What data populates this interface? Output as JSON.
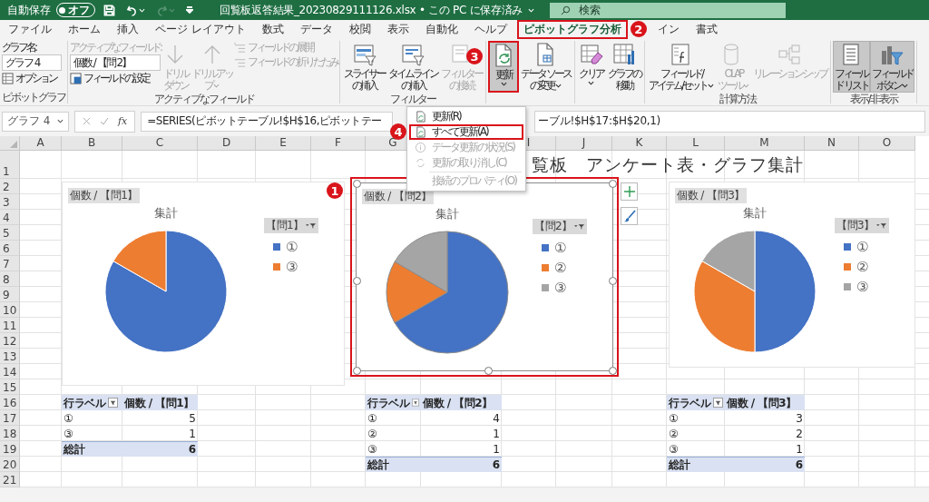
{
  "title_bar": {
    "autosave_label": "自動保存",
    "autosave_toggle": {
      "label": "オフ",
      "on": false
    },
    "quick_access": [
      {
        "kind": "save",
        "disabled": false
      },
      {
        "kind": "undo",
        "disabled": false
      },
      {
        "kind": "redo",
        "disabled": true
      },
      {
        "kind": "customize",
        "disabled": false
      }
    ],
    "filename": "回覧板返答結果_20230829111126.xlsx • この PC に保存済み",
    "search": {
      "placeholder": "検索"
    }
  },
  "tabs": [
    {
      "label": "ファイル",
      "selected": false,
      "highlighted": false
    },
    {
      "label": "ホーム",
      "selected": false,
      "highlighted": false
    },
    {
      "label": "挿入",
      "selected": false,
      "highlighted": false
    },
    {
      "label": "ページ レイアウト",
      "selected": false,
      "highlighted": false
    },
    {
      "label": "数式",
      "selected": false,
      "highlighted": false
    },
    {
      "label": "データ",
      "selected": false,
      "highlighted": false
    },
    {
      "label": "校閲",
      "selected": false,
      "highlighted": false
    },
    {
      "label": "表示",
      "selected": false,
      "highlighted": false
    },
    {
      "label": "自動化",
      "selected": false,
      "highlighted": false
    },
    {
      "label": "ヘルプ",
      "selected": false,
      "highlighted": false
    },
    {
      "label": "ピボットグラフ分析",
      "selected": true,
      "highlighted": true,
      "badge": "2"
    },
    {
      "label": "イン",
      "selected": false,
      "highlighted": false
    },
    {
      "label": "書式",
      "selected": false,
      "highlighted": false
    }
  ],
  "ribbon": {
    "groups": [
      {
        "label": "ピボットグラフ",
        "columns": [
          [
            {
              "kind": "caption",
              "label": "グラフ名:",
              "disabled": false
            },
            {
              "kind": "field",
              "value": "グラフ 4"
            },
            {
              "kind": "small",
              "label": "オプション",
              "disabled": false
            }
          ]
        ]
      },
      {
        "label": "アクティブなフィールド",
        "columns": [
          [
            {
              "kind": "caption",
              "label": "アクティブなフィールド:",
              "disabled": true
            },
            {
              "kind": "field",
              "value": "個数 / 【問 2】"
            },
            {
              "kind": "small",
              "label": "フィールドの設定",
              "disabled": false
            }
          ],
          [
            {
              "kind": "large",
              "lines": [
                "ドリル",
                "ダウン"
              ],
              "disabled": true,
              "pressed": false,
              "dropdown": false,
              "highlighted": false
            }
          ],
          [
            {
              "kind": "large",
              "lines": [
                "ドリルアッ",
                "プ"
              ],
              "disabled": true,
              "pressed": false,
              "dropdown": true,
              "highlighted": false
            }
          ],
          [
            {
              "kind": "small",
              "label": "フィールドの展開",
              "disabled": true
            },
            {
              "kind": "small",
              "label": "フィールドの折りたたみ",
              "disabled": true
            }
          ]
        ]
      },
      {
        "label": "フィルター",
        "columns": [
          [
            {
              "kind": "large",
              "lines": [
                "スライサー",
                "の挿入"
              ],
              "disabled": false,
              "pressed": false,
              "dropdown": false,
              "highlighted": false
            }
          ],
          [
            {
              "kind": "large",
              "lines": [
                "タイムライン",
                "の挿入"
              ],
              "disabled": false,
              "pressed": false,
              "dropdown": false,
              "highlighted": false
            }
          ],
          [
            {
              "kind": "large",
              "lines": [
                "フィルター",
                "の接続"
              ],
              "disabled": true,
              "pressed": false,
              "dropdown": false,
              "highlighted": false
            }
          ]
        ]
      },
      {
        "columns": [
          [
            {
              "kind": "large",
              "lines": [
                "更新"
              ],
              "disabled": false,
              "pressed": true,
              "dropdown": true,
              "highlighted": true,
              "badge": "3",
              "menu": {
                "items": [
                  {
                    "label": "更新(R)",
                    "disabled": false,
                    "highlighted": false
                  },
                  {
                    "label": "すべて更新(A)",
                    "disabled": false,
                    "highlighted": true,
                    "badge": "4"
                  },
                  {
                    "label": "データ更新の状況(S)",
                    "disabled": true,
                    "highlighted": false
                  },
                  {
                    "label": "更新の取り消し(C)",
                    "disabled": true,
                    "highlighted": false
                  },
                  {
                    "label": "接続のプロパティ(O)",
                    "disabled": true,
                    "highlighted": false
                  }
                ]
              }
            }
          ],
          [
            {
              "kind": "large",
              "lines": [
                "データ ソース",
                "の変更"
              ],
              "disabled": false,
              "pressed": false,
              "dropdown": true,
              "highlighted": false
            }
          ]
        ]
      },
      {
        "columns": [
          [
            {
              "kind": "large",
              "lines": [
                "クリア"
              ],
              "disabled": false,
              "pressed": false,
              "dropdown": true,
              "highlighted": false
            }
          ],
          [
            {
              "kind": "large",
              "lines": [
                "グラフの",
                "移動"
              ],
              "disabled": false,
              "pressed": false,
              "dropdown": false,
              "highlighted": false
            }
          ]
        ]
      },
      {
        "label": "計算方法",
        "columns": [
          [
            {
              "kind": "large",
              "lines": [
                "フィールド/",
                "アイテム/セット"
              ],
              "disabled": false,
              "pressed": false,
              "dropdown": true,
              "highlighted": false
            }
          ],
          [
            {
              "kind": "large",
              "lines": [
                "OLAP",
                "ツール"
              ],
              "disabled": true,
              "pressed": false,
              "dropdown": true,
              "highlighted": false
            }
          ],
          [
            {
              "kind": "large",
              "lines": [
                "リレーションシップ"
              ],
              "disabled": true,
              "pressed": false,
              "dropdown": false,
              "highlighted": false
            }
          ]
        ]
      },
      {
        "label": "表示/非表示",
        "columns": [
          [
            {
              "kind": "large",
              "lines": [
                "フィール",
                "ド リスト"
              ],
              "disabled": false,
              "pressed": true,
              "dropdown": false,
              "highlighted": false
            }
          ],
          [
            {
              "kind": "large",
              "lines": [
                "フィールド",
                "ボタン"
              ],
              "disabled": false,
              "pressed": true,
              "dropdown": true,
              "highlighted": false
            }
          ]
        ]
      }
    ]
  },
  "formula_bar": {
    "name_box": "グラフ 4",
    "function_button": "fx",
    "formula_start": "=SERIES(ピボットテーブル!$H$16,ピボットテー",
    "formula_end": "ーブル!$H$17:$H$20,1)"
  },
  "sheet": {
    "columns": [
      {
        "label": "A"
      },
      {
        "label": "B"
      },
      {
        "label": "C"
      },
      {
        "label": "D"
      },
      {
        "label": "E"
      },
      {
        "label": "F"
      },
      {
        "label": "G"
      },
      {},
      {
        "label": "I"
      },
      {
        "label": "J"
      },
      {
        "label": "K"
      },
      {
        "label": "L"
      },
      {
        "label": "M"
      },
      {
        "label": "N"
      },
      {
        "label": "O"
      }
    ],
    "rows": [
      "1",
      "2",
      "3",
      "4",
      "5",
      "6",
      "7",
      "8",
      "9",
      "10",
      "11",
      "12",
      "13",
      "14",
      "15",
      "16",
      "17",
      "18",
      "19",
      "20",
      "21"
    ],
    "title": "覧板　アンケート表・グラフ集計",
    "charts": [
      {
        "field_button": "個数 / 【問1】",
        "legend_button": "【問1】",
        "selected": false,
        "highlighted": false,
        "legend": [
          {
            "label": "①",
            "color": "#4472c4"
          },
          {
            "label": "③",
            "color": "#ed7d31"
          }
        ],
        "chart_data": {
          "type": "pie",
          "title": "集計",
          "series": [
            {
              "values": [
                83.3,
                16.7
              ]
            }
          ]
        }
      },
      {
        "field_button": "個数 / 【問2】",
        "legend_button": "【問2】",
        "selected": true,
        "highlighted": true,
        "badge": "1",
        "legend": [
          {
            "label": "①",
            "color": "#4472c4"
          },
          {
            "label": "②",
            "color": "#ed7d31"
          },
          {
            "label": "③",
            "color": "#a5a5a5"
          }
        ],
        "chart_data": {
          "type": "pie",
          "title": "集計",
          "series": [
            {
              "values": [
                66.7,
                16.7,
                16.6
              ]
            }
          ]
        }
      },
      {
        "field_button": "個数 / 【問3】",
        "legend_button": "【問3】",
        "selected": false,
        "highlighted": false,
        "legend": [
          {
            "label": "①",
            "color": "#4472c4"
          },
          {
            "label": "②",
            "color": "#ed7d31"
          },
          {
            "label": "③",
            "color": "#a5a5a5"
          }
        ],
        "chart_data": {
          "type": "pie",
          "title": "集計",
          "series": [
            {
              "values": [
                50,
                33.3,
                16.7
              ]
            }
          ]
        }
      }
    ],
    "pivot_tables": [
      {
        "row_header": "行ラベル",
        "value_header": "個数 / 【問1】",
        "rows": [
          {
            "label": "①",
            "value": "5"
          },
          {
            "label": "③",
            "value": "1"
          }
        ],
        "total": {
          "label": "総計",
          "value": "6"
        }
      },
      {
        "row_header": "行ラベル",
        "value_header": "個数 / 【問2】",
        "rows": [
          {
            "label": "①",
            "value": "4"
          },
          {
            "label": "②",
            "value": "1"
          },
          {
            "label": "③",
            "value": "1"
          }
        ],
        "total": {
          "label": "総計",
          "value": "6"
        }
      },
      {
        "row_header": "行ラベル",
        "value_header": "個数 / 【問3】",
        "rows": [
          {
            "label": "①",
            "value": "3"
          },
          {
            "label": "②",
            "value": "2"
          },
          {
            "label": "③",
            "value": "1"
          }
        ],
        "total": {
          "label": "総計",
          "value": "6"
        }
      }
    ]
  }
}
